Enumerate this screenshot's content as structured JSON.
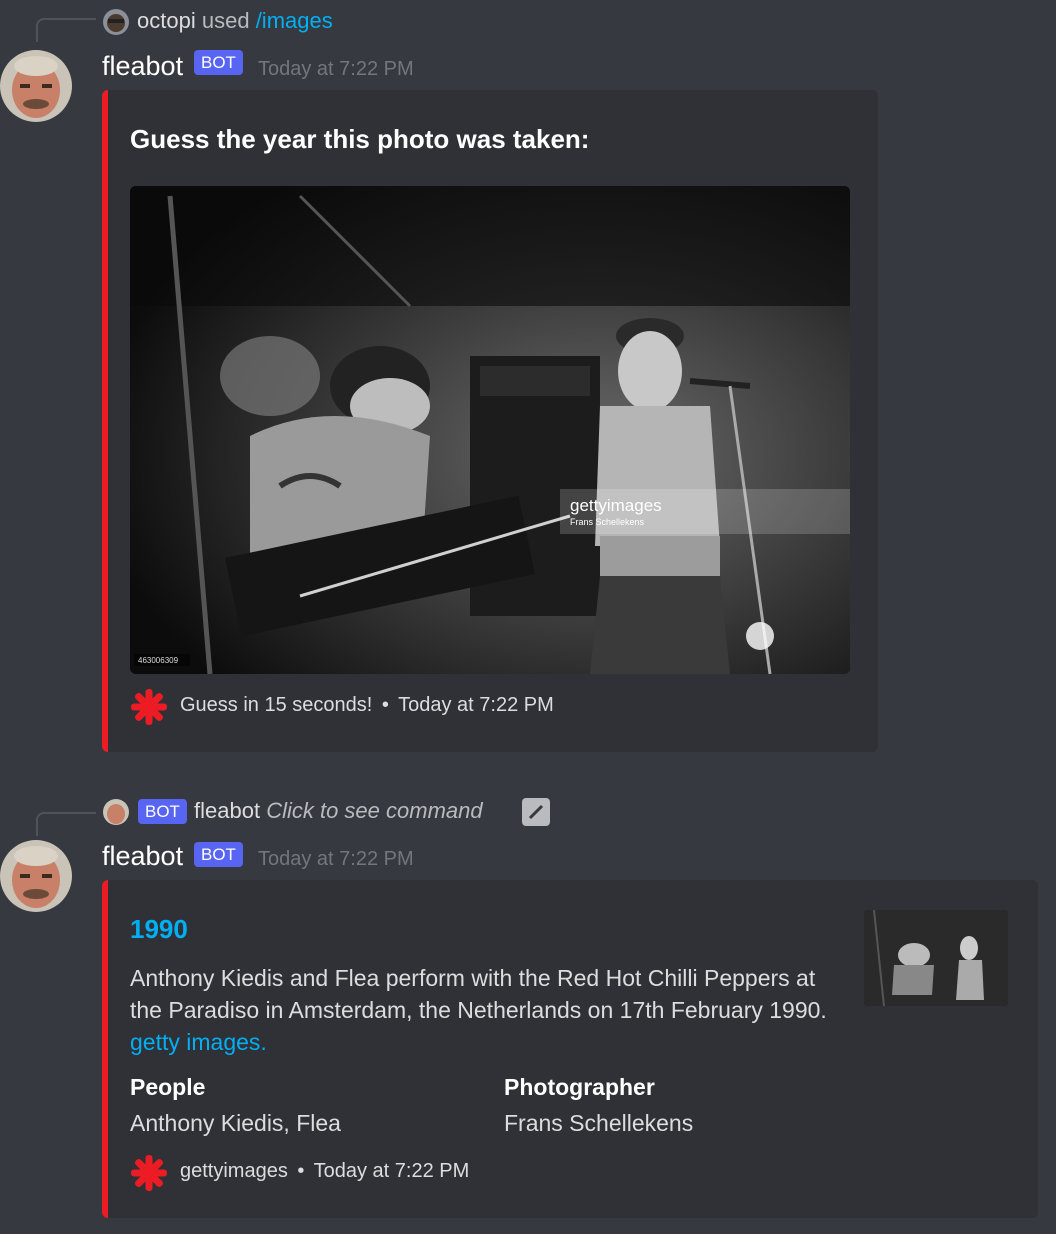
{
  "message1": {
    "reply": {
      "user": "octopi",
      "used": "used",
      "command": "/images"
    },
    "username": "fleabot",
    "bot_tag": "BOT",
    "timestamp": "Today at 7:22 PM",
    "embed": {
      "title": "Guess the year this photo was taken:",
      "image_watermark_brand": "gettyimages",
      "image_watermark_credit": "Frans Schellekens",
      "image_id": "463006309",
      "footer_text": "Guess in 15 seconds!",
      "footer_sep": "•",
      "footer_time": "Today at 7:22 PM"
    }
  },
  "message2": {
    "reply": {
      "bot_tag": "BOT",
      "user": "fleabot",
      "hint": "Click to see command"
    },
    "username": "fleabot",
    "bot_tag": "BOT",
    "timestamp": "Today at 7:22 PM",
    "embed": {
      "title": "1990",
      "description": "Anthony Kiedis and Flea perform with the Red Hot Chilli Peppers at the Paradiso in Amsterdam, the Netherlands on 17th February 1990.",
      "link_text": "getty images.",
      "fields": [
        {
          "name": "People",
          "value": "Anthony Kiedis, Flea"
        },
        {
          "name": "Photographer",
          "value": "Frans Schellekens"
        }
      ],
      "footer_text": "gettyimages",
      "footer_sep": "•",
      "footer_time": "Today at 7:22 PM"
    }
  },
  "colors": {
    "background": "#36393f",
    "embed_bg": "#2f3136",
    "embed_accent": "#ed1c24",
    "bot_tag": "#5865f2",
    "link": "#00aff4"
  },
  "icons": [
    "avatar-fleabot",
    "avatar-octopi",
    "rhcp-asterisk-icon",
    "edit-icon"
  ]
}
